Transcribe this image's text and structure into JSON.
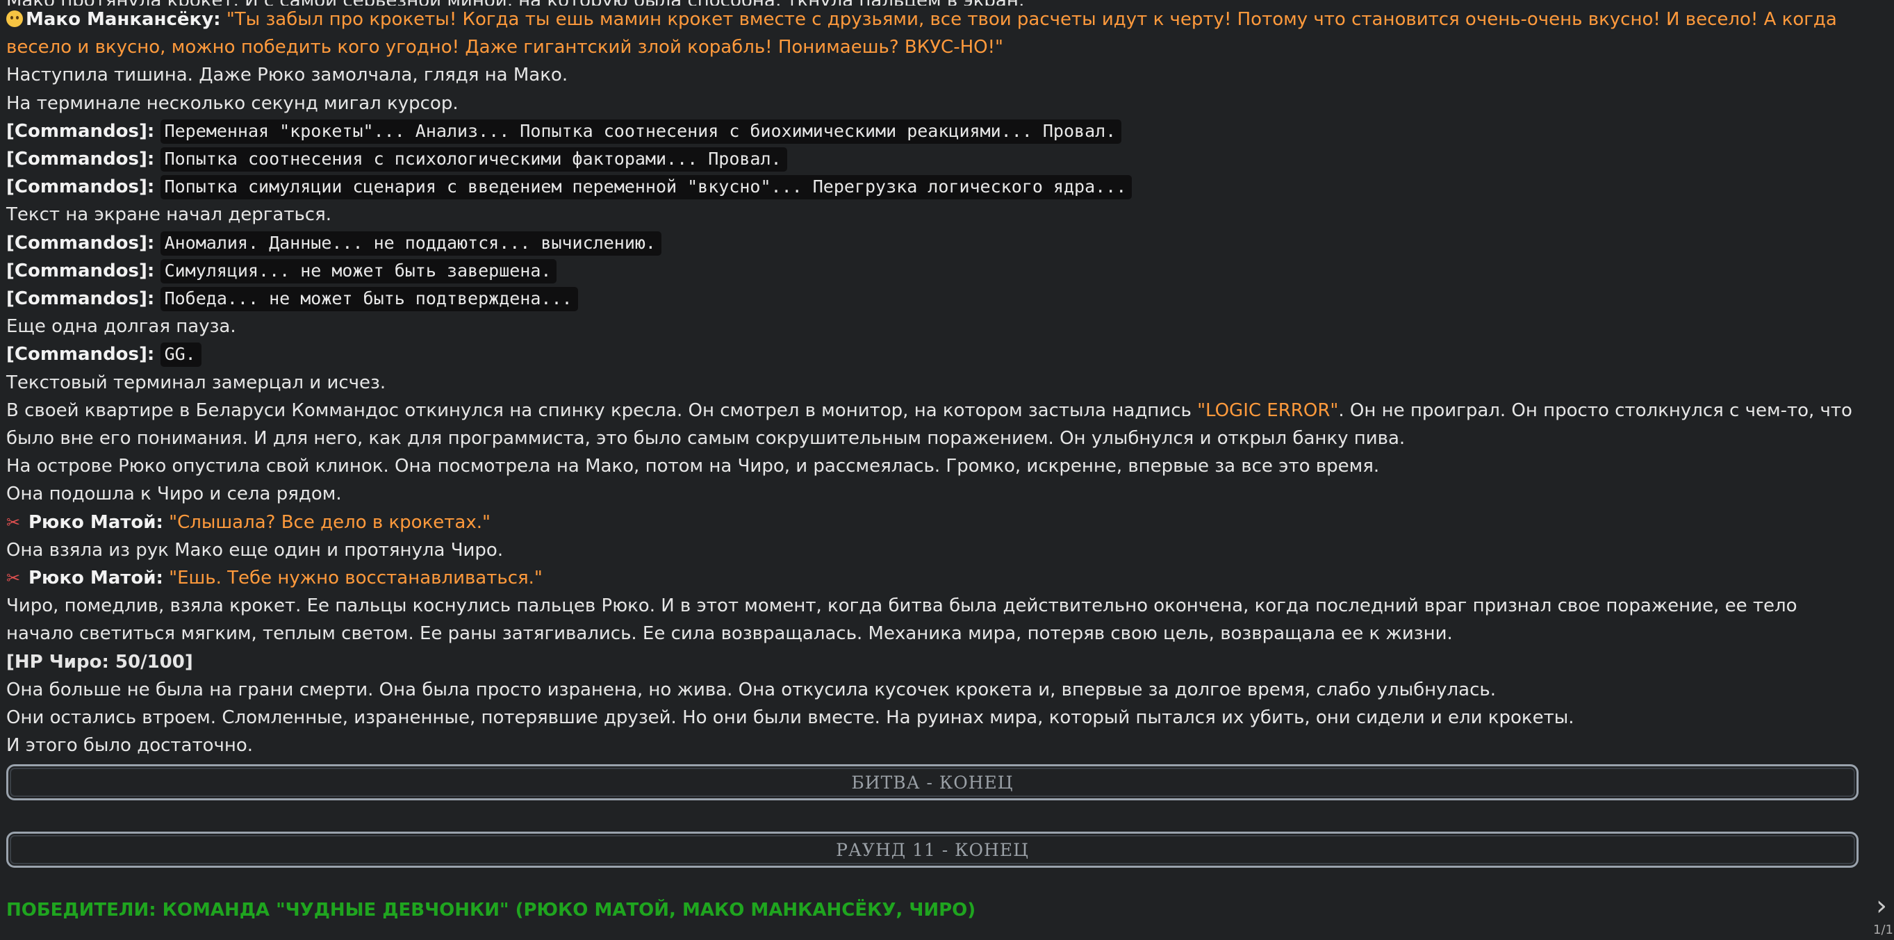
{
  "lines": [
    "Мако протянула крокет. И с самой серьезной миной, на которую была способна, ткнула пальцем в экран:",
    "Наступила тишина. Даже Рюко замолчала, глядя на Мако.",
    "На терминале несколько секунд мигал курсор.",
    "Текст на экране начал дергаться.",
    "Еще одна долгая пауза.",
    "Текстовый терминал замерцал и исчез.",
    "На острове Рюко опустила свой клинок. Она посмотрела на Мако, потом на Чиро, и рассмеялась. Громко, искренне, впервые за все это время.",
    "Она подошла к Чиро и села рядом.",
    "Она взяла из рук Мако еще один и протянула Чиро.",
    "Чиро, помедлив, взяла крокет. Ее пальцы коснулись пальцев Рюко. И в этот момент, когда битва была действительно окончена, когда последний враг признал свое поражение, ее тело начало светиться мягким, теплым светом. Ее раны затягивались. Ее сила возвращалась. Механика мира, потеряв свою цель, возвращала ее к жизни.",
    "[HP Чиро: 50/100]",
    "Она больше не была на грани смерти. Она была просто изранена, но жива. Она откусила кусочек крокета и, впервые за долгое время, слабо улыбнулась.",
    "Они остались втроем. Сломленные, израненные, потерявшие друзей. Но они были вместе. На руинах мира, который пытался их убить, они сидели и ели крокеты.",
    "И этого было достаточно."
  ],
  "mako": {
    "name": "Мако Манкансёку:",
    "quote": "\"Ты забыл про крокеты! Когда ты ешь мамин крокет вместе с друзьями, все твои расчеты идут к черту! Потому что становится очень-очень вкусно! И весело! А когда весело и вкусно, можно победить кого угодно! Даже гигантский злой корабль! Понимаешь? ВКУС-НО!\""
  },
  "ryuko": {
    "name": "Рюко Матой:",
    "quote1": "\"Слышала? Все дело в крокетах.\"",
    "quote2": "\"Ешь. Тебе нужно восстанавливаться.\""
  },
  "commandos_label": "[Commandos]:",
  "commandos": [
    "Переменная \"крокеты\"... Анализ... Попытка соотнесения с биохимическими реакциями... Провал.",
    "Попытка соотнесения с психологическими факторами... Провал.",
    "Попытка симуляции сценария с введением переменной \"вкусно\"... Перегрузка логического ядра...",
    "Аномалия. Данные... не поддаются... вычислению.",
    "Симуляция... не может быть завершена.",
    "Победа... не может быть подтверждена...",
    "GG."
  ],
  "belarus": {
    "before": "В своей квартире в Беларуси Коммандос откинулся на спинку кресла. Он смотрел в монитор, на котором застыла надпись ",
    "highlight": "\"LOGIC ERROR\"",
    "after": ". Он не проиграл. Он просто столкнулся с чем-то, что было вне его понимания. И для него, как для программиста, это было самым сокрушительным поражением. Он улыбнулся и открыл банку пива."
  },
  "dividers": {
    "battle_end": "БИТВА - КОНЕЦ",
    "round_end": "РАУНД 11 - КОНЕЦ"
  },
  "winners": "ПОБЕДИТЕЛИ: КОМАНДА \"ЧУДНЫЕ ДЕВЧОНКИ\" (РЮКО МАТОЙ, МАКО МАНКАНСЁКУ, ЧИРО)",
  "pagination": {
    "next_icon": "chevron-right-icon",
    "indicator": "1/1"
  },
  "colors": {
    "background": "#202224",
    "quote": "#ff9a3c",
    "winners": "#1fa51f",
    "divider_border": "#9aa3ad"
  }
}
